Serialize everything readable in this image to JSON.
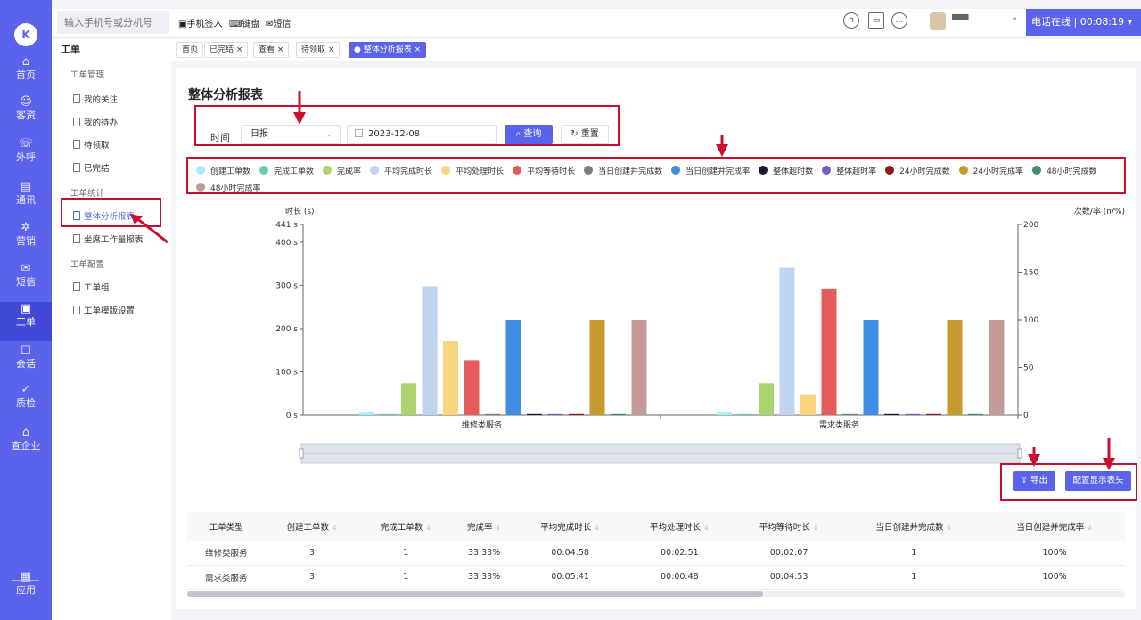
{
  "rail": {
    "items": [
      {
        "label": "首页",
        "icon": "home-icon",
        "glyph": "⌂"
      },
      {
        "label": "客资",
        "icon": "contacts-icon",
        "glyph": "☺"
      },
      {
        "label": "外呼",
        "icon": "outbound-call-icon",
        "glyph": "☏"
      },
      {
        "label": "通讯",
        "icon": "address-book-icon",
        "glyph": "▤"
      },
      {
        "label": "营销",
        "icon": "marketing-icon",
        "glyph": "✲"
      },
      {
        "label": "短信",
        "icon": "sms-icon",
        "glyph": "✉"
      },
      {
        "label": "工单",
        "icon": "ticket-icon",
        "glyph": "▣"
      },
      {
        "label": "会话",
        "icon": "chat-icon",
        "glyph": "☐"
      },
      {
        "label": "质检",
        "icon": "quality-check-icon",
        "glyph": "✓"
      },
      {
        "label": "查企业",
        "icon": "enterprise-icon",
        "glyph": "⌂"
      },
      {
        "label": "应用",
        "icon": "apps-icon",
        "glyph": "▦"
      }
    ],
    "active_index": 6
  },
  "topbar": {
    "phone_placeholder": "输入手机号或分机号",
    "links": [
      "手机签入",
      "键盘",
      "短信"
    ],
    "online_status": "电话在线 |",
    "timer": "00:08:19"
  },
  "section_title": "工单",
  "tabs": [
    {
      "label": "首页"
    },
    {
      "label": "已完结 ×"
    },
    {
      "label": "查看 ×"
    },
    {
      "label": "待领取 ×"
    },
    {
      "label": "● 整体分析报表 ×",
      "active": true
    }
  ],
  "sidebar": {
    "groups": [
      "工单管理",
      "工单统计",
      "工单配置"
    ],
    "items": [
      "我的关注",
      "我的待办",
      "待领取",
      "已完结",
      "整体分析报表",
      "坐席工作量报表",
      "工单组",
      "工单模版设置"
    ]
  },
  "page": {
    "title": "整体分析报表",
    "filter_label": "时间",
    "period_value": "日报",
    "date_value": "2023-12-08",
    "query_label": "查询",
    "reset_label": "重置",
    "export_label": "导出",
    "config_label": "配置显示表头"
  },
  "accent_color": "#5b63eb",
  "chart_data": {
    "type": "bar",
    "categories": [
      "维修类服务",
      "需求类服务"
    ],
    "left_axis_label": "时长 (s)",
    "right_axis_label": "次数/率 (n/%)",
    "left_ticks": [
      "0 s",
      "100 s",
      "200 s",
      "300 s",
      "400 s",
      "441 s"
    ],
    "right_ticks": [
      "0",
      "50",
      "100",
      "150",
      "200"
    ],
    "left_max": 441,
    "right_max": 200,
    "legend_position": "top",
    "series": [
      {
        "name": "创建工单数",
        "color": "#a8f0f5",
        "axis": "right",
        "values": [
          3,
          3
        ]
      },
      {
        "name": "完成工单数",
        "color": "#6ecba8",
        "axis": "right",
        "values": [
          1,
          1
        ]
      },
      {
        "name": "完成率",
        "color": "#a9d46f",
        "axis": "right",
        "values": [
          33.33,
          33.33
        ]
      },
      {
        "name": "平均完成时长",
        "color": "#c0d3ef",
        "axis": "left",
        "values": [
          298,
          341
        ]
      },
      {
        "name": "平均处理时长",
        "color": "#f8d57e",
        "axis": "left",
        "values": [
          171,
          48
        ]
      },
      {
        "name": "平均等待时长",
        "color": "#e45b5b",
        "axis": "left",
        "values": [
          127,
          293
        ]
      },
      {
        "name": "当日创建并完成数",
        "color": "#7a7a7a",
        "axis": "right",
        "values": [
          1,
          1
        ]
      },
      {
        "name": "当日创建并完成率",
        "color": "#3e8de3",
        "axis": "right",
        "values": [
          100,
          100
        ]
      },
      {
        "name": "整体超时数",
        "color": "#1a1a2e",
        "axis": "right",
        "values": [
          0,
          0
        ]
      },
      {
        "name": "整体超时率",
        "color": "#7b5bc4",
        "axis": "right",
        "values": [
          0,
          0
        ]
      },
      {
        "name": "24小时完成数",
        "color": "#8b1a1a",
        "axis": "right",
        "values": [
          1,
          1
        ]
      },
      {
        "name": "24小时完成率",
        "color": "#c49a2e",
        "axis": "right",
        "values": [
          100,
          100
        ]
      },
      {
        "name": "48小时完成数",
        "color": "#3f8f6a",
        "axis": "right",
        "values": [
          1,
          1
        ]
      },
      {
        "name": "48小时完成率",
        "color": "#c49a98",
        "axis": "right",
        "values": [
          100,
          100
        ]
      }
    ]
  },
  "table": {
    "headers": [
      "工单类型",
      "创建工单数",
      "完成工单数",
      "完成率",
      "平均完成时长",
      "平均处理时长",
      "平均等待时长",
      "当日创建并完成数",
      "当日创建并完成率"
    ],
    "rows": [
      [
        "维修类服务",
        "3",
        "1",
        "33.33%",
        "00:04:58",
        "00:02:51",
        "00:02:07",
        "1",
        "100%"
      ],
      [
        "需求类服务",
        "3",
        "1",
        "33.33%",
        "00:05:41",
        "00:00:48",
        "00:04:53",
        "1",
        "100%"
      ]
    ]
  }
}
